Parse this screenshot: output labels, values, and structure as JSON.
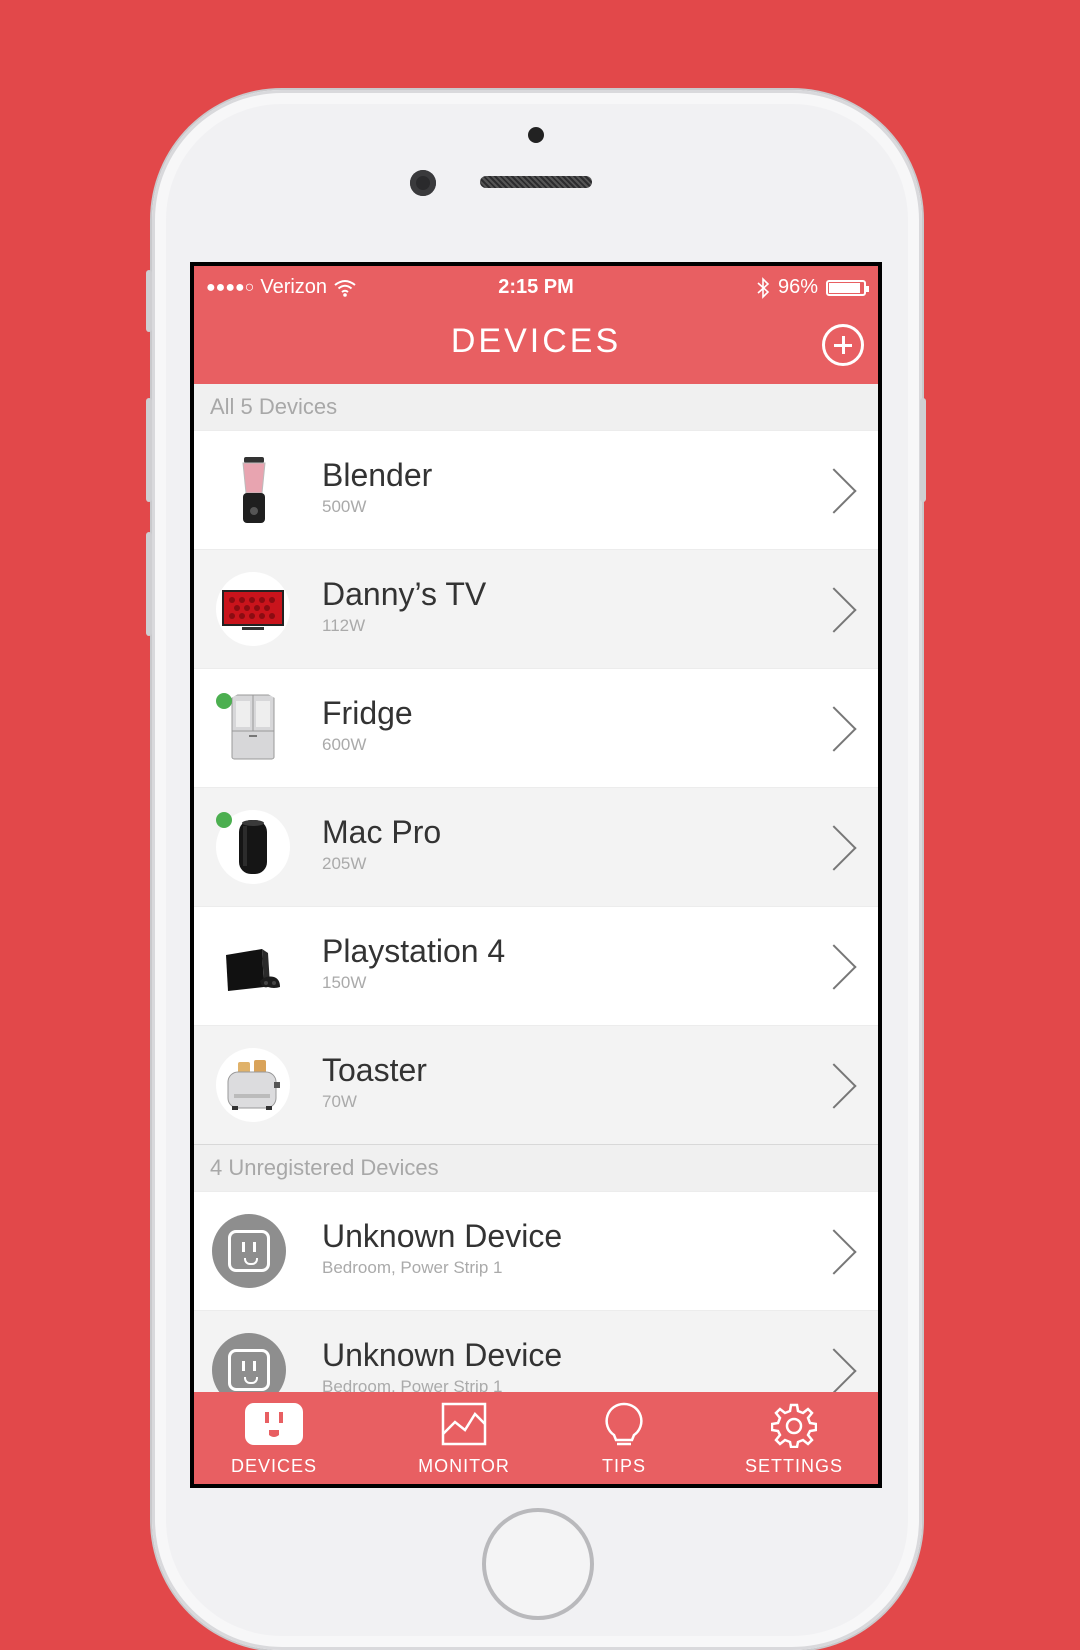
{
  "status_bar": {
    "signal": "●●●●○",
    "carrier": "Verizon",
    "time": "2:15 PM",
    "battery": "96%"
  },
  "header": {
    "title": "DEVICES",
    "add_icon": "plus-circle-icon"
  },
  "sections": {
    "registered": {
      "title": "All 5 Devices",
      "items": [
        {
          "name": "Blender",
          "sub": "500W",
          "online": false,
          "icon": "blender-icon"
        },
        {
          "name": "Danny’s TV",
          "sub": "112W",
          "online": false,
          "icon": "tv-icon"
        },
        {
          "name": "Fridge",
          "sub": "600W",
          "online": true,
          "icon": "fridge-icon"
        },
        {
          "name": "Mac Pro",
          "sub": "205W",
          "online": true,
          "icon": "mac-pro-icon"
        },
        {
          "name": "Playstation 4",
          "sub": "150W",
          "online": false,
          "icon": "playstation-icon"
        },
        {
          "name": "Toaster",
          "sub": "70W",
          "online": false,
          "icon": "toaster-icon"
        }
      ]
    },
    "unregistered": {
      "title": "4 Unregistered Devices",
      "items": [
        {
          "name": "Unknown Device",
          "sub": "Bedroom, Power Strip 1",
          "icon": "outlet-icon"
        },
        {
          "name": "Unknown Device",
          "sub": "Bedroom, Power Strip 1",
          "icon": "outlet-icon"
        }
      ]
    }
  },
  "tabbar": {
    "devices": "DEVICES",
    "monitor": "MONITOR",
    "tips": "TIPS",
    "settings": "SETTINGS",
    "active": "devices"
  },
  "colors": {
    "background": "#e2484a",
    "accent": "#e85f62",
    "online": "#4caf50"
  }
}
